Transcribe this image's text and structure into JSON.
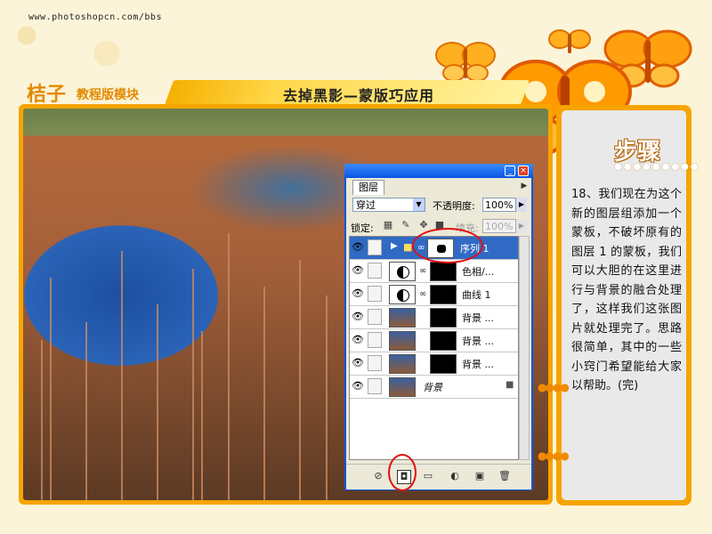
{
  "site": {
    "url": "www.photoshopcn.com/bbs"
  },
  "brand": {
    "name": "桔子",
    "subtitle": "教程版模块"
  },
  "tutorial": {
    "title": "去掉黑影—蒙版巧应用"
  },
  "steps": {
    "heading": "步骤",
    "dots": "●●●●●●●●●",
    "body": "18、我们现在为这个新的图层组添加一个蒙板，不破坏原有的图层 1 的蒙板，我们可以大胆的在这里进行与背景的融合处理了，这样我们这张图片就处理完了。思路很简单，其中的一些小窍门希望能给大家以帮助。(完)"
  },
  "photoshop": {
    "panel_tab": "图层",
    "blend_mode": "穿过",
    "opacity_label": "不透明度:",
    "opacity_value": "100%",
    "lock_label": "锁定:",
    "fill_label": "填充:",
    "fill_value": "100%",
    "layers": [
      {
        "name": "序列 1",
        "type": "group",
        "selected": true
      },
      {
        "name": "色相/...",
        "type": "adjustment"
      },
      {
        "name": "曲线 1",
        "type": "adjustment"
      },
      {
        "name": "背景 ...",
        "type": "photo"
      },
      {
        "name": "背景 ...",
        "type": "photo"
      },
      {
        "name": "背景 ...",
        "type": "photo"
      },
      {
        "name": "背景",
        "type": "background",
        "locked": true
      }
    ]
  },
  "colors": {
    "accent": "#f6a400",
    "selection": "#316ac5",
    "titlebar": "#0a54e0",
    "highlight_ring": "#e01010"
  }
}
